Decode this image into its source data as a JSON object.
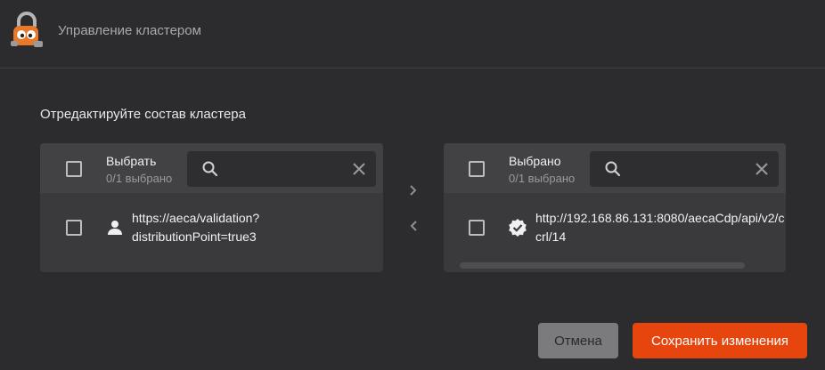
{
  "header": {
    "logo_icon": "padlock-mascot-logo",
    "title": "Управление кластером"
  },
  "editor": {
    "title": "Отредактируйте состав кластера",
    "left": {
      "header_title": "Выбрать",
      "count": "0/1 выбрано",
      "search_placeholder": "",
      "items": [
        {
          "icon": "person-icon",
          "text": "https://aeca/validation?\ndistributionPoint=true3"
        }
      ]
    },
    "right": {
      "header_title": "Выбрано",
      "count": "0/1 выбрано",
      "search_placeholder": "",
      "items": [
        {
          "icon": "verified-badge-icon",
          "text": "http://192.168.86.131:8080/aecaCdp/api/v2/c\ncrl/14"
        }
      ]
    },
    "move_right_icon": "chevron-right-icon",
    "move_left_icon": "chevron-left-icon"
  },
  "footer": {
    "cancel_label": "Отмена",
    "save_label": "Сохранить изменения"
  },
  "colors": {
    "accent": "#e6460d",
    "background": "#2c2c2e",
    "panel": "#3a3a3c"
  }
}
